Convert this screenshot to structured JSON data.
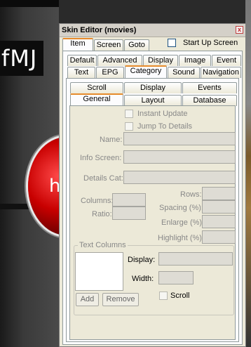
{
  "background": {
    "logo_text": "fMJ",
    "ball_letter": "h"
  },
  "window": {
    "title": "Skin Editor (movies)",
    "close_glyph": "x"
  },
  "top_tabs": [
    "Item",
    "Screen",
    "Goto"
  ],
  "start_up_screen_label": "Start Up Screen",
  "category_tabs_row1": [
    "Default",
    "Advanced",
    "Display",
    "Image",
    "Event"
  ],
  "category_tabs_row2": [
    "Text",
    "EPG",
    "Category",
    "Sound",
    "Navigation"
  ],
  "sub_tabs_row1": [
    "Scroll",
    "Display",
    "Events"
  ],
  "sub_tabs_row2": [
    "General",
    "Layout",
    "Database"
  ],
  "general": {
    "instant_update": "Instant Update",
    "jump_to_details": "Jump To Details",
    "name_label": "Name:",
    "info_screen_label": "Info Screen:",
    "details_cat_label": "Details Cat:",
    "columns_label": "Columns:",
    "ratio_label": "Ratio:",
    "rows_label": "Rows:",
    "spacing_label": "Spacing (%):",
    "enlarge_label": "Enlarge (%):",
    "highlight_label": "Highlight (%):"
  },
  "text_columns": {
    "legend": "Text Columns",
    "display_label": "Display:",
    "width_label": "Width:",
    "scroll_label": "Scroll",
    "add_button": "Add",
    "remove_button": "Remove"
  }
}
